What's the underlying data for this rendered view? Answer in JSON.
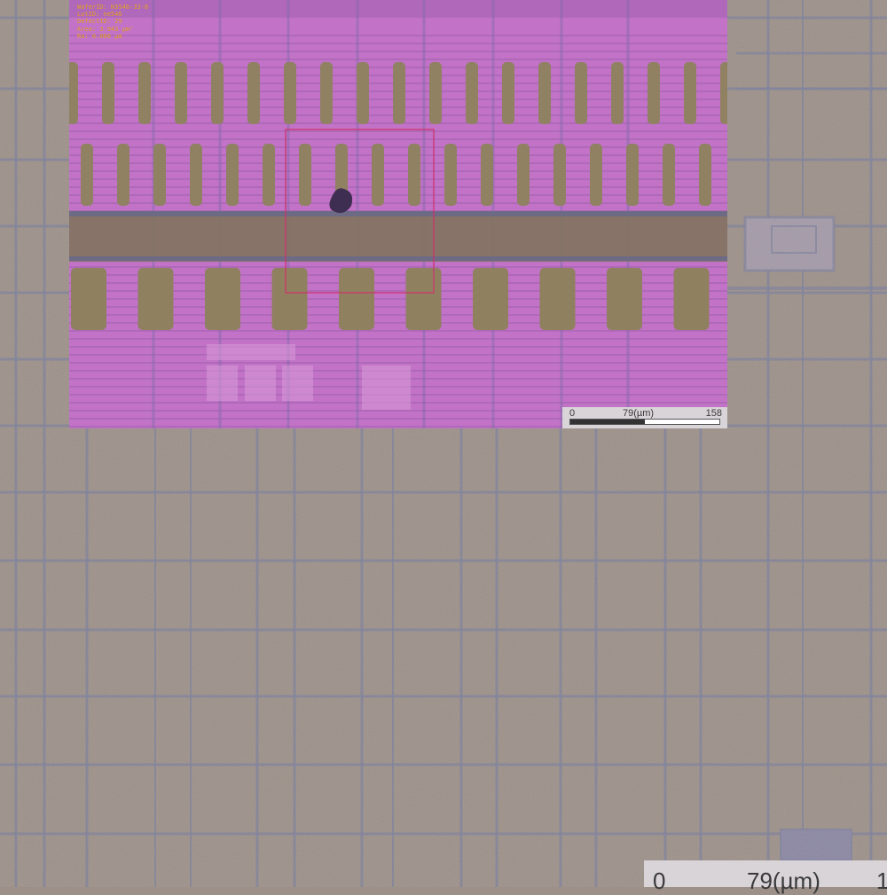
{
  "inset": {
    "metadata_lines": [
      "WaferID: N3546-33-8",
      "LotID: ne546",
      "DefectID: 29",
      "Area: 3.943 µm²",
      "Ra: 0.000 µm"
    ],
    "scale_bar": {
      "start": "0",
      "mid": "79(µm)",
      "end": "158"
    }
  },
  "main_scale_bar": {
    "start": "0",
    "mid": "79(µm)",
    "end": "1"
  },
  "colors": {
    "substrate": "#9c9088",
    "grid_line": "#7a7e9a",
    "inset_overlay": "#c872c8",
    "pad": "#8f8060",
    "defect_box": "#d0306a"
  }
}
